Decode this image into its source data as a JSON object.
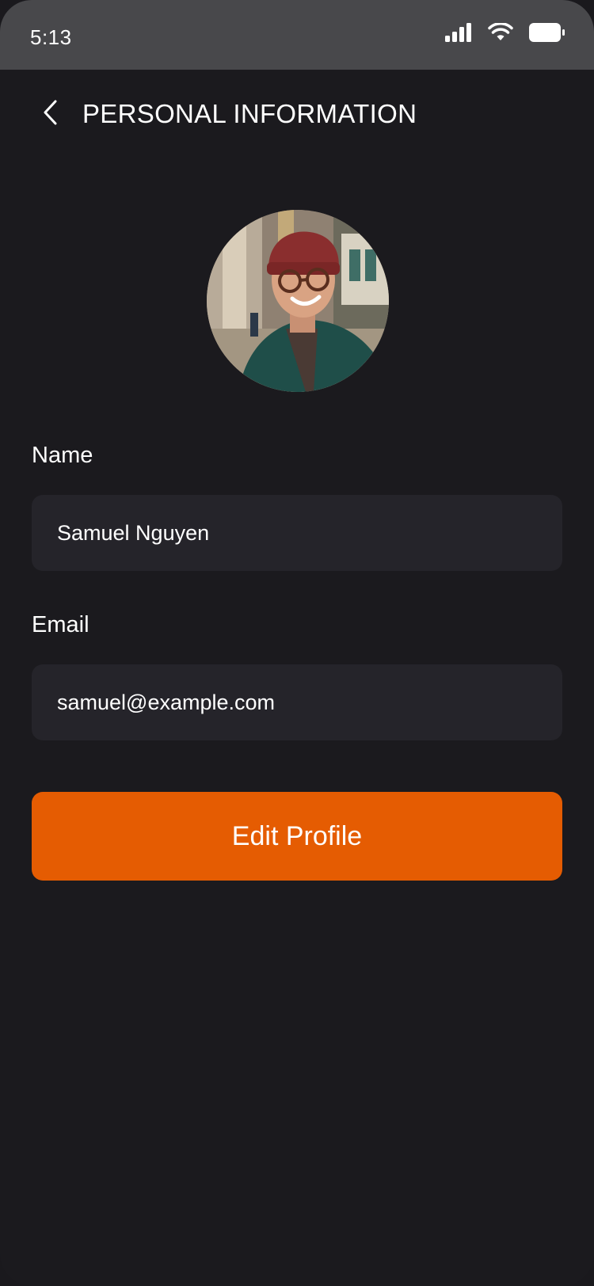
{
  "status_bar": {
    "time": "5:13",
    "icons": [
      "cellular-signal-icon",
      "wifi-icon",
      "battery-icon"
    ]
  },
  "header": {
    "back_icon": "chevron-left-icon",
    "title": "PERSONAL INFORMATION"
  },
  "profile": {
    "avatar": "user-avatar-photo"
  },
  "form": {
    "name_label": "Name",
    "name_value": "Samuel Nguyen",
    "email_label": "Email",
    "email_value": "samuel@example.com"
  },
  "actions": {
    "edit_label": "Edit Profile"
  },
  "colors": {
    "background": "#1b1a1e",
    "status_bar": "#48484b",
    "field": "#25242a",
    "accent": "#e55c02",
    "text": "#ffffff"
  }
}
